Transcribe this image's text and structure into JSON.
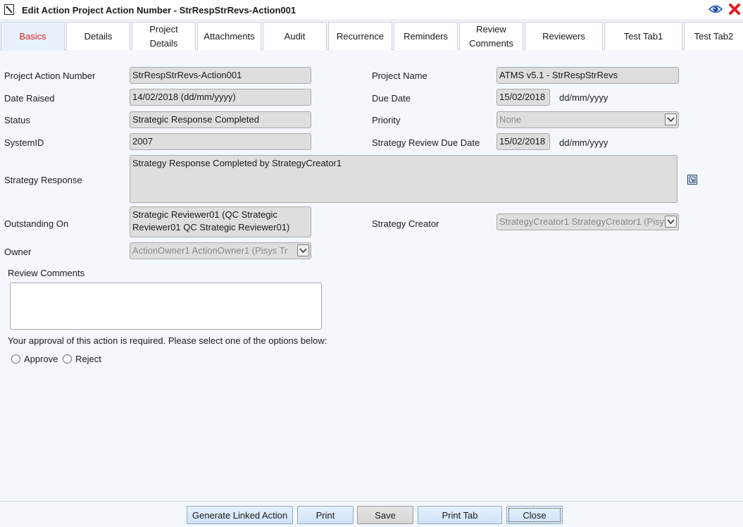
{
  "window": {
    "title": "Edit Action Project Action Number - StrRespStrRevs-Action001"
  },
  "tabs": [
    {
      "label": "Basics",
      "active": true
    },
    {
      "label": "Details"
    },
    {
      "label": "Project\nDetails"
    },
    {
      "label": "Attachments"
    },
    {
      "label": "Audit"
    },
    {
      "label": "Recurrence"
    },
    {
      "label": "Reminders"
    },
    {
      "label": "Review\nComments"
    },
    {
      "label": "Reviewers"
    },
    {
      "label": "Test Tab1"
    },
    {
      "label": "Test Tab2"
    }
  ],
  "form": {
    "project_action_number": {
      "label": "Project Action Number",
      "value": "StrRespStrRevs-Action001"
    },
    "project_name": {
      "label": "Project Name",
      "value": "ATMS v5.1 - StrRespStrRevs"
    },
    "date_raised": {
      "label": "Date Raised",
      "value": "14/02/2018 (dd/mm/yyyy)"
    },
    "due_date": {
      "label": "Due Date",
      "value": "15/02/2018",
      "format": "dd/mm/yyyy"
    },
    "status": {
      "label": "Status",
      "value": "Strategic Response Completed"
    },
    "priority": {
      "label": "Priority",
      "value": "None"
    },
    "system_id": {
      "label": "SystemID",
      "value": "2007"
    },
    "strategy_review_due_date": {
      "label": "Strategy Review Due Date",
      "value": "15/02/2018",
      "format": "dd/mm/yyyy"
    },
    "strategy_response": {
      "label": "Strategy Response",
      "value": "Strategy Response Completed by StrategyCreator1"
    },
    "outstanding_on": {
      "label": "Outstanding On",
      "value": "Strategic Reviewer01 (QC Strategic Reviewer01 QC Strategic Reviewer01)"
    },
    "strategy_creator": {
      "label": "Strategy Creator",
      "value": "StrategyCreator1 StrategyCreator1 (Pisys"
    },
    "owner": {
      "label": "Owner",
      "value": "ActionOwner1 ActionOwner1 (Pisys Tr"
    },
    "review_comments": {
      "label": "Review Comments",
      "value": ""
    },
    "approval_prompt": "Your approval of this action is required. Please select one of the options below:",
    "approve_label": "Approve",
    "reject_label": "Reject"
  },
  "footer": {
    "generate_linked_action": "Generate Linked Action",
    "print": "Print",
    "save": "Save",
    "print_tab": "Print Tab",
    "close": "Close"
  },
  "colors": {
    "active_tab_text": "#e0201e",
    "close_icon": "#e02020",
    "eye_icon": "#1a4fa0"
  }
}
